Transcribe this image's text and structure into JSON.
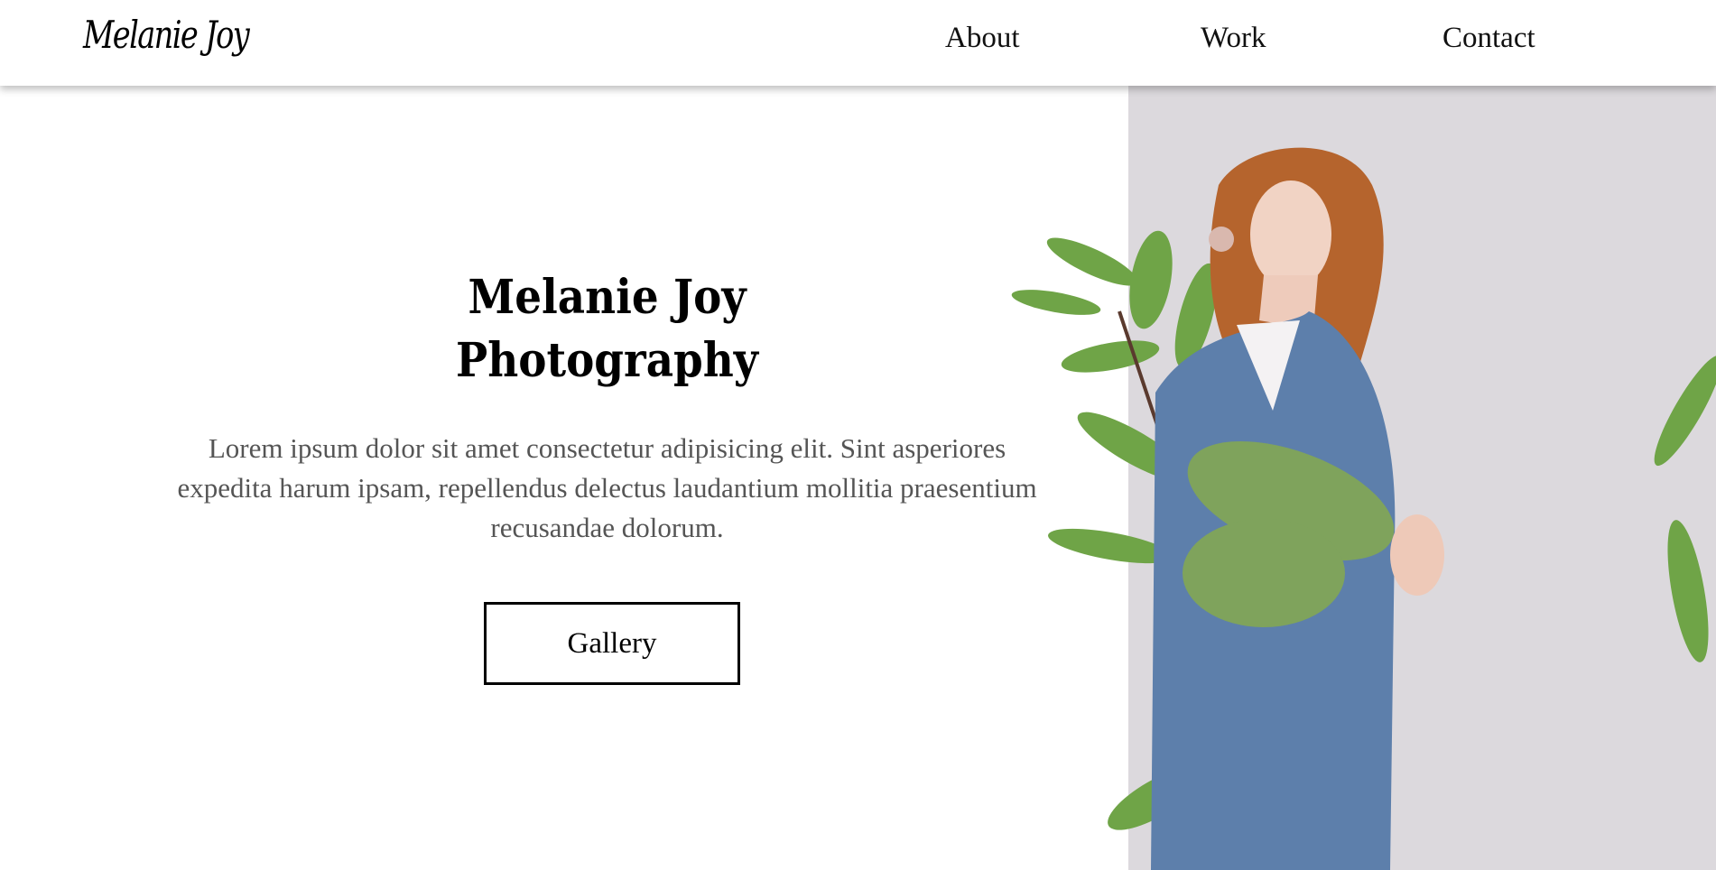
{
  "header": {
    "logo": "Melanie Joy",
    "nav": [
      {
        "label": "About"
      },
      {
        "label": "Work"
      },
      {
        "label": "Contact"
      }
    ]
  },
  "hero": {
    "title_line1": "Melanie Joy",
    "title_line2": "Photography",
    "description": "Lorem ipsum dolor sit amet consectetur adipisicing elit. Sint asperiores expedita harum ipsam, repellendus delectus laudantium mollitia praesentium recusandae dolorum.",
    "button_label": "Gallery"
  },
  "colors": {
    "photo_background": "#dcd9dd",
    "text": "#555555"
  }
}
